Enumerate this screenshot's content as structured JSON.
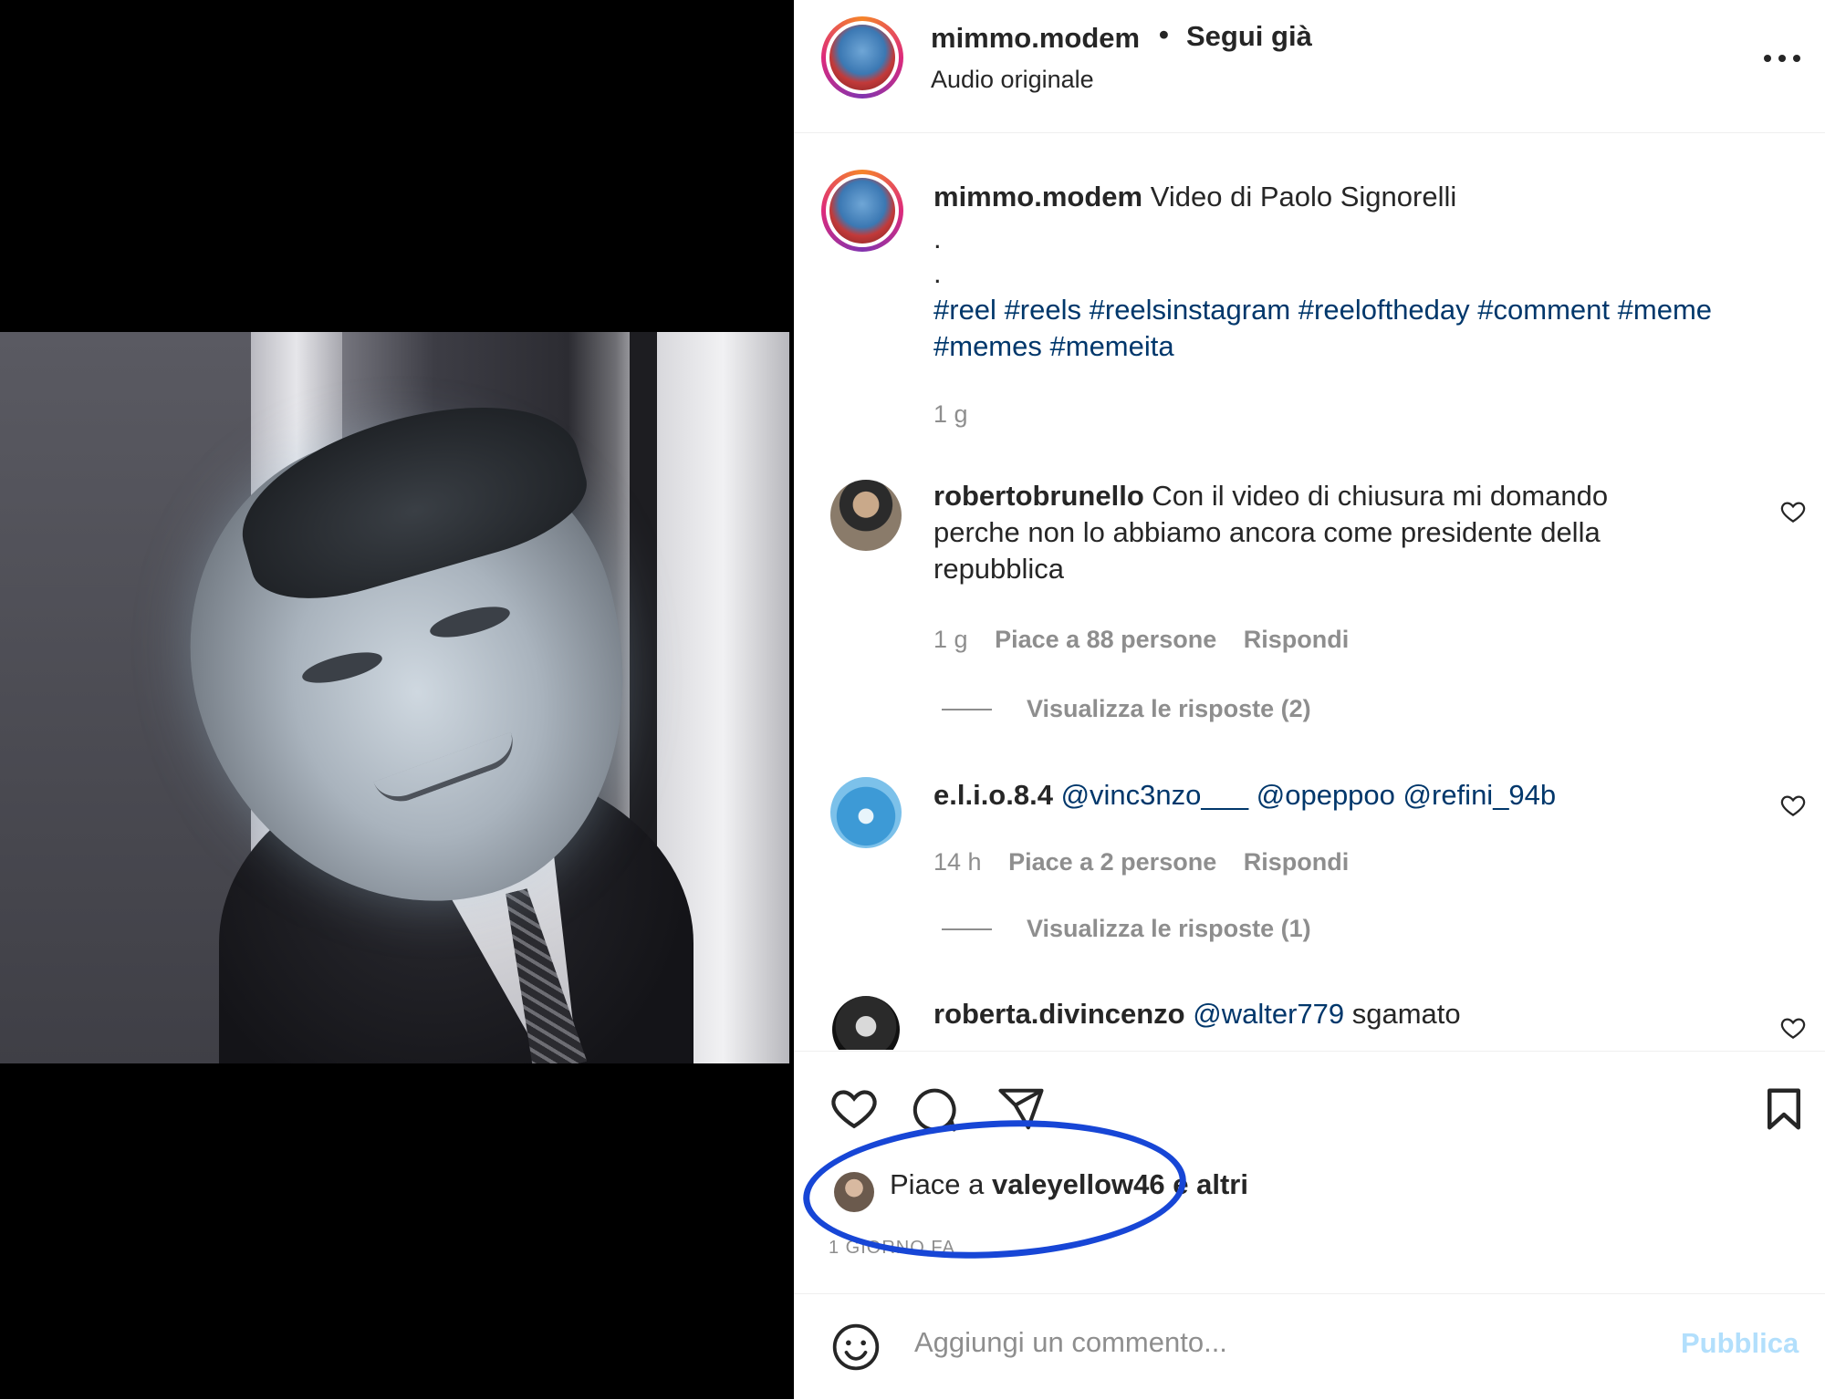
{
  "post": {
    "author": "mimmo.modem",
    "separator": "•",
    "follow_status": "Segui già",
    "audio": "Audio originale"
  },
  "caption": {
    "user": "mimmo.modem",
    "text": "Video di Paolo Signorelli",
    "dot1": ".",
    "dot2": ".",
    "hashtags_line1": [
      "#reel",
      "#reels",
      "#reelsinstagram",
      "#reeloftheday",
      "#comment",
      "#meme"
    ],
    "hashtags_line2": [
      "#memes",
      "#memeita"
    ],
    "time": "1 g"
  },
  "comments": [
    {
      "user": "robertobrunello",
      "text_line1": "Con il video di chiusura mi domando",
      "text_line2": "perche non lo abbiamo ancora come presidente della",
      "text_line3": "repubblica",
      "time": "1 g",
      "likes": "Piace a 88 persone",
      "reply": "Rispondi",
      "view_replies": "Visualizza le risposte (2)"
    },
    {
      "user": "e.l.i.o.8.4",
      "mentions": [
        "@vinc3nzo___",
        "@opeppoo",
        "@refini_94b"
      ],
      "time": "14 h",
      "likes": "Piace a 2 persone",
      "reply": "Rispondi",
      "view_replies": "Visualizza le risposte (1)"
    },
    {
      "user": "roberta.divincenzo",
      "mention": "@walter779",
      "text": "sgamato"
    }
  ],
  "actions": {
    "likes_prefix": "Piace a",
    "likes_user": "valeyellow46",
    "likes_suffix": "e altri",
    "time_ago": "1 GIORNO FA"
  },
  "composer": {
    "placeholder": "Aggiungi un commento...",
    "publish": "Pubblica"
  },
  "colors": {
    "link": "#00376b",
    "muted": "#8e8e8e",
    "publish_disabled": "#b2dffc",
    "highlight": "#1746d6"
  },
  "icons": [
    "emoji-icon",
    "heart-icon",
    "comment-icon",
    "share-icon",
    "bookmark-icon",
    "more-icon"
  ]
}
